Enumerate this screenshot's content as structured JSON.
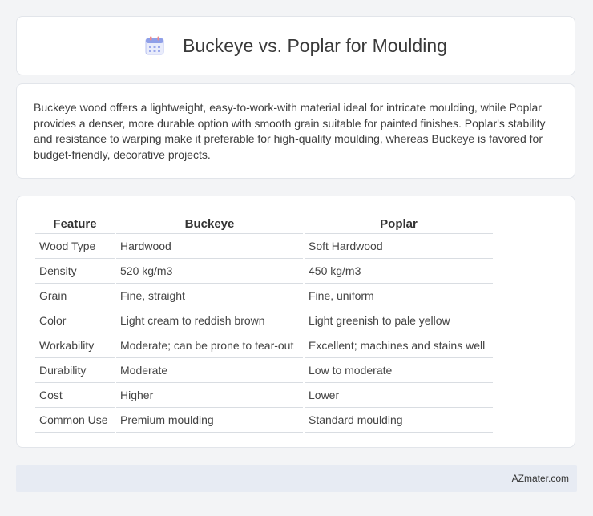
{
  "header": {
    "title": "Buckeye vs. Poplar for Moulding",
    "icon": "calendar-icon"
  },
  "summary": {
    "text": "Buckeye wood offers a lightweight, easy-to-work-with material ideal for intricate moulding, while Poplar provides a denser, more durable option with smooth grain suitable for painted finishes. Poplar's stability and resistance to warping make it preferable for high-quality moulding, whereas Buckeye is favored for budget-friendly, decorative projects."
  },
  "table": {
    "headers": [
      "Feature",
      "Buckeye",
      "Poplar"
    ],
    "rows": [
      [
        "Wood Type",
        "Hardwood",
        "Soft Hardwood"
      ],
      [
        "Density",
        "520 kg/m3",
        "450 kg/m3"
      ],
      [
        "Grain",
        "Fine, straight",
        "Fine, uniform"
      ],
      [
        "Color",
        "Light cream to reddish brown",
        "Light greenish to pale yellow"
      ],
      [
        "Workability",
        "Moderate; can be prone to tear-out",
        "Excellent; machines and stains well"
      ],
      [
        "Durability",
        "Moderate",
        "Low to moderate"
      ],
      [
        "Cost",
        "Higher",
        "Lower"
      ],
      [
        "Common Use",
        "Premium moulding",
        "Standard moulding"
      ]
    ]
  },
  "footer": {
    "text": "AZmater.com"
  },
  "colors": {
    "background": "#f3f4f6",
    "card": "#ffffff",
    "footer": "#e7ebf3",
    "icon_accent": "#7b8ee6"
  }
}
